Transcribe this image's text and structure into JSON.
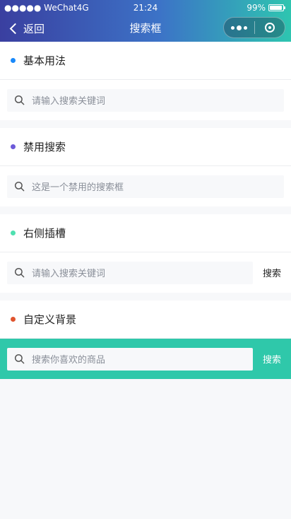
{
  "status_bar": {
    "carrier": "●●●●● WeChat4G",
    "time": "21:24",
    "battery": "99%"
  },
  "navbar": {
    "back_label": "返回",
    "title": "搜索框"
  },
  "sections": [
    {
      "title": "基本用法",
      "dot_color": "#1989fa",
      "placeholder": "请输入搜索关键词"
    },
    {
      "title": "禁用搜索",
      "dot_color": "#6c5ad9",
      "placeholder": "这是一个禁用的搜索框"
    },
    {
      "title": "右侧插槽",
      "dot_color": "#4fe0b0",
      "placeholder": "请输入搜索关键词",
      "action": "搜索"
    },
    {
      "title": "自定义背景",
      "dot_color": "#e0542e",
      "placeholder": "搜索你喜欢的商品",
      "action": "搜索",
      "background": "#2fc8aa"
    }
  ],
  "icons": {
    "back": "chevron-left-icon",
    "more": "more-dots-icon",
    "close": "target-circle-icon",
    "search": "search-icon"
  }
}
